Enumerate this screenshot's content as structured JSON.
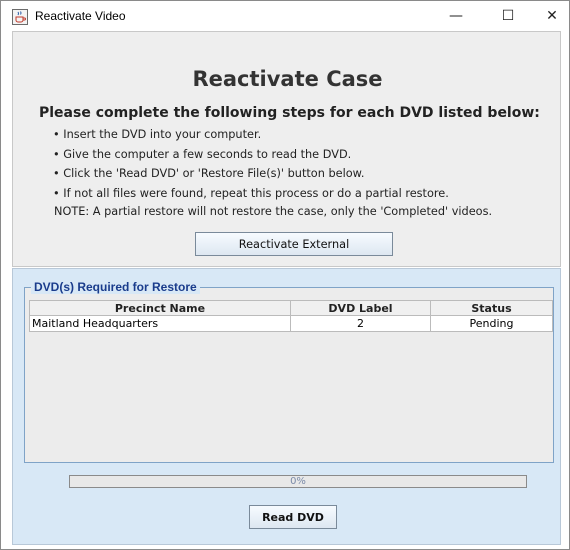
{
  "window": {
    "title": "Reactivate Video",
    "icon": "java-cup-icon",
    "controls": {
      "minimize": "—",
      "maximize": "☐",
      "close": "✕"
    }
  },
  "instructions": {
    "heading": "Reactivate Case",
    "subheading": "Please complete the following steps for each DVD listed below:",
    "steps": [
      "Insert the DVD into your computer.",
      "Give the computer a few seconds to read the DVD.",
      "Click the 'Read DVD' or 'Restore File(s)' button below.",
      "If not all files were found, repeat this process or do a partial restore."
    ],
    "note": "NOTE: A partial restore will not restore the case, only the 'Completed' videos.",
    "reactivate_button": "Reactivate External"
  },
  "dvd_group": {
    "legend": "DVD(s) Required for Restore",
    "columns": [
      "Precinct Name",
      "DVD Label",
      "Status"
    ],
    "rows": [
      [
        "Maitland Headquarters",
        "2",
        "Pending"
      ]
    ]
  },
  "progress": {
    "value": 0,
    "text": "0%"
  },
  "read_button": "Read DVD",
  "colors": {
    "top_panel": "#eeeeee",
    "bottom_panel": "#d8e8f6",
    "legend_text": "#1a3c8c"
  }
}
